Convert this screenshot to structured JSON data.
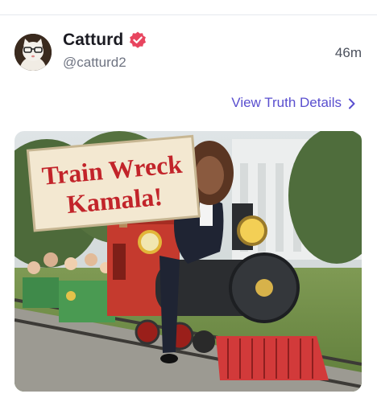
{
  "post": {
    "author": {
      "display_name": "Catturd",
      "handle": "@catturd2",
      "verified": true,
      "avatar_icon": "cat-avatar"
    },
    "timestamp": "46m",
    "view_details_label": "View Truth Details",
    "media": {
      "sign_text_line1": "Train Wreck",
      "sign_text_line2": "Kamala!"
    }
  },
  "colors": {
    "verified_badge": "#e8455f",
    "link": "#5a4fcf",
    "sign_text": "#c2242a"
  }
}
